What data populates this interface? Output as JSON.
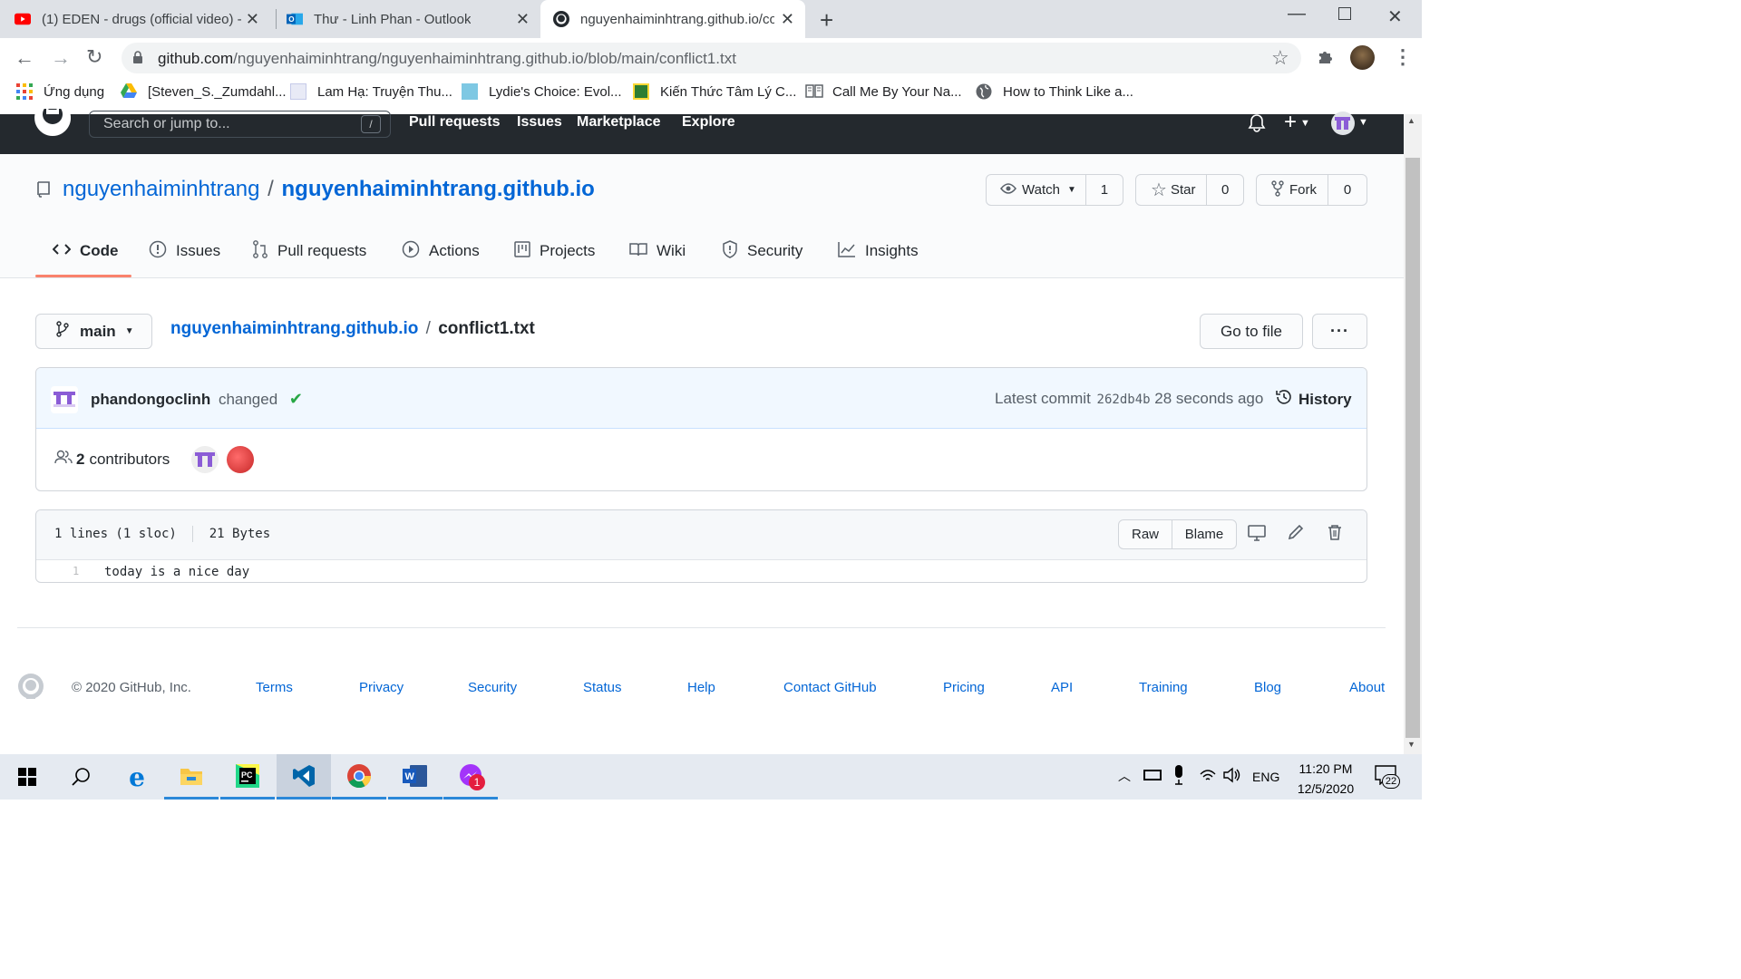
{
  "browser": {
    "tabs": [
      {
        "title": "(1) EDEN - drugs (official video) -"
      },
      {
        "title": "Thư - Linh Phan - Outlook"
      },
      {
        "title": "nguyenhaiminhtrang.github.io/co"
      }
    ],
    "url_host": "github.com",
    "url_path": "/nguyenhaiminhtrang/nguyenhaiminhtrang.github.io/blob/main/conflict1.txt",
    "bookmarks": [
      {
        "label": "Ứng dụng"
      },
      {
        "label": "[Steven_S._Zumdahl..."
      },
      {
        "label": "Lam Hạ: Truyện Thu..."
      },
      {
        "label": "Lydie's Choice: Evol..."
      },
      {
        "label": "Kiến Thức Tâm Lý C..."
      },
      {
        "label": "Call Me By Your Na..."
      },
      {
        "label": "How to Think Like a..."
      }
    ]
  },
  "github": {
    "search_placeholder": "Search or jump to...",
    "search_key": "/",
    "nav": [
      "Pull requests",
      "Issues",
      "Marketplace",
      "Explore"
    ],
    "repo": {
      "owner": "nguyenhaiminhtrang",
      "separator": "/",
      "name": "nguyenhaiminhtrang.github.io",
      "watch_label": "Watch",
      "watch_count": "1",
      "star_label": "Star",
      "star_count": "0",
      "fork_label": "Fork",
      "fork_count": "0"
    },
    "tabs": [
      "Code",
      "Issues",
      "Pull requests",
      "Actions",
      "Projects",
      "Wiki",
      "Security",
      "Insights"
    ],
    "file": {
      "branch": "main",
      "repo_link": "nguyenhaiminhtrang.github.io",
      "separator": "/",
      "filename": "conflict1.txt",
      "go_to_file": "Go to file",
      "more": "···"
    },
    "commit": {
      "author": "phandongoclinh",
      "message": "changed",
      "latest_label": "Latest commit",
      "sha": "262db4b",
      "time": "28 seconds ago",
      "history": "History"
    },
    "contributors": {
      "count": "2",
      "label": "contributors"
    },
    "blob": {
      "lines_info": "1 lines (1 sloc)",
      "size": "21 Bytes",
      "raw": "Raw",
      "blame": "Blame",
      "lines": [
        {
          "num": "1",
          "text": "today is a nice day"
        }
      ]
    },
    "footer": {
      "copyright": "© 2020 GitHub, Inc.",
      "links": [
        "Terms",
        "Privacy",
        "Security",
        "Status",
        "Help",
        "Contact GitHub",
        "Pricing",
        "API",
        "Training",
        "Blog",
        "About"
      ]
    }
  },
  "taskbar": {
    "lang": "ENG",
    "time": "11:20 PM",
    "date": "12/5/2020",
    "notif_count": "22",
    "messenger_badge": "1"
  },
  "colors": {
    "link": "#0366d6",
    "gh_header": "#24292e",
    "accent_underline": "#f9826c",
    "commit_bg": "#f1f8ff"
  }
}
